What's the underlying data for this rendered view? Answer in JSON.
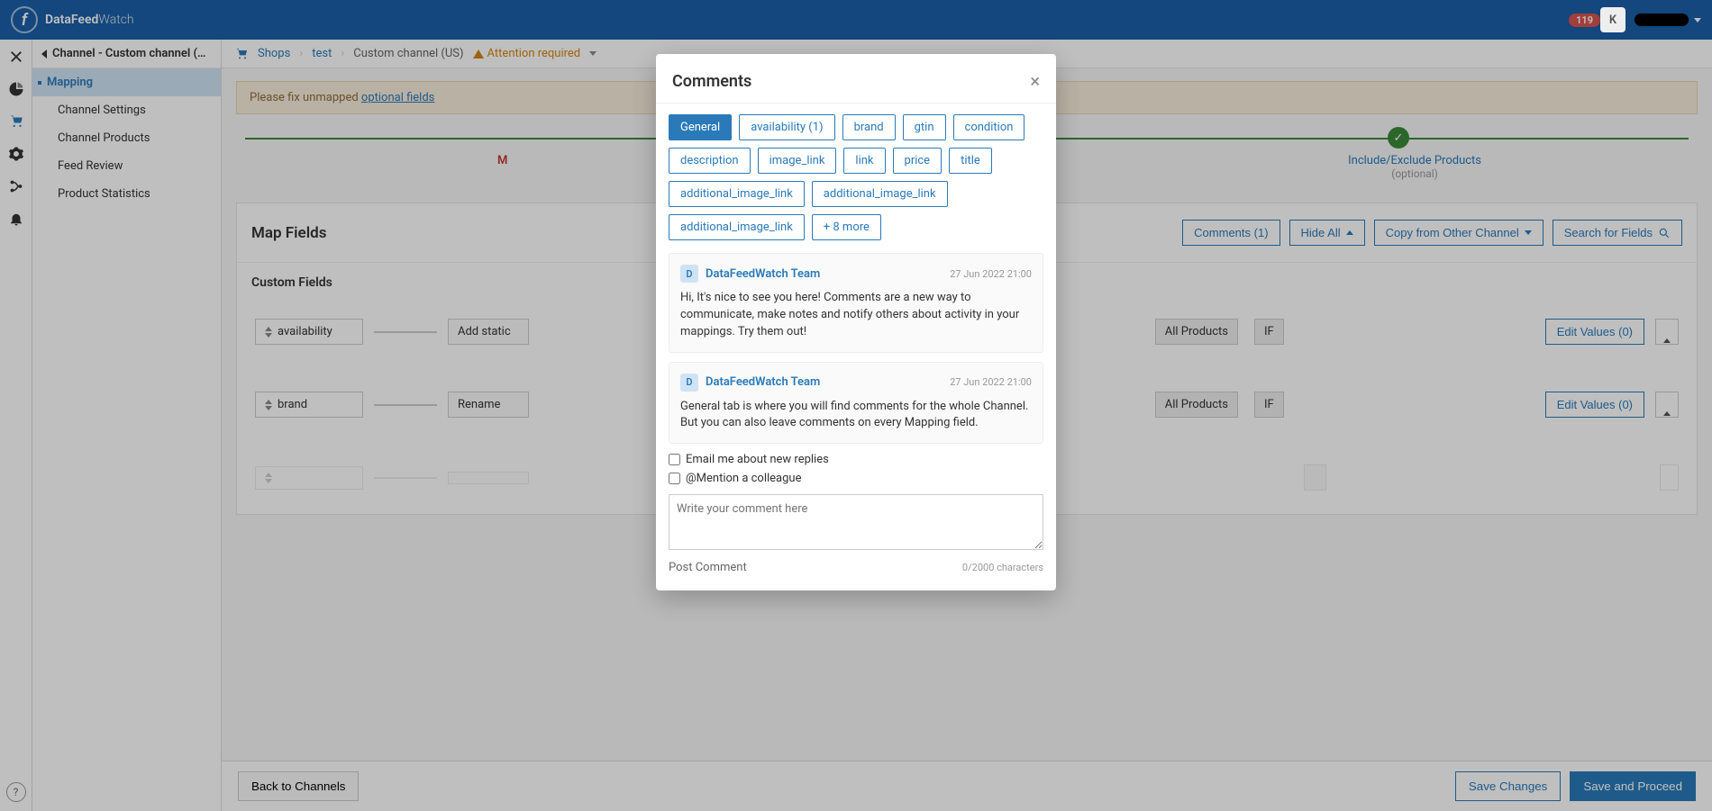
{
  "brand": {
    "name_bold": "DataFeed",
    "name_light": "Watch"
  },
  "header": {
    "notification_count": "119",
    "avatar_initial": "K"
  },
  "sidepanel": {
    "title": "Channel - Custom channel (…",
    "items": [
      "Mapping",
      "Channel Settings",
      "Channel Products",
      "Feed Review",
      "Product Statistics"
    ]
  },
  "breadcrumb": {
    "shops": "Shops",
    "shop": "test",
    "channel": "Custom channel (US)",
    "warn": "Attention required"
  },
  "alert": {
    "text": "Please fix unmapped ",
    "link": "optional fields"
  },
  "steps": {
    "left_partial": "M",
    "right_title": "Include/Exclude Products",
    "right_sub": "(optional)"
  },
  "map": {
    "title": "Map Fields",
    "actions": {
      "comments": "Comments (1)",
      "hide": "Hide All",
      "copy": "Copy from Other Channel",
      "search": "Search for Fields"
    },
    "section": "Custom Fields",
    "row1": {
      "field": "availability",
      "action": "Add static",
      "all": "All Products",
      "if": "IF",
      "edit": "Edit Values (0)"
    },
    "row2": {
      "field": "brand",
      "action": "Rename",
      "all": "All Products",
      "if": "IF",
      "edit": "Edit Values (0)"
    }
  },
  "footer": {
    "back": "Back to Channels",
    "save": "Save Changes",
    "proceed": "Save and Proceed"
  },
  "modal": {
    "title": "Comments",
    "chips": [
      "General",
      "availability (1)",
      "brand",
      "gtin",
      "condition",
      "description",
      "image_link",
      "link",
      "price",
      "title",
      "additional_image_link",
      "additional_image_link",
      "additional_image_link",
      "+ 8 more"
    ],
    "comments": [
      {
        "initial": "D",
        "author": "DataFeedWatch Team",
        "ts": "27 Jun 2022 21:00",
        "text": "Hi, It's nice to see you here! Comments are a new way to communicate, make notes and notify others about activity in your mappings. Try them out!"
      },
      {
        "initial": "D",
        "author": "DataFeedWatch Team",
        "ts": "27 Jun 2022 21:00",
        "text": "General tab is where you will find comments for the whole Channel. But you can also leave comments on every Mapping field."
      }
    ],
    "check_email": "Email me about new replies",
    "check_mention": "@Mention a colleague",
    "placeholder": "Write your comment here",
    "post": "Post Comment",
    "chars": "0/2000 characters"
  }
}
